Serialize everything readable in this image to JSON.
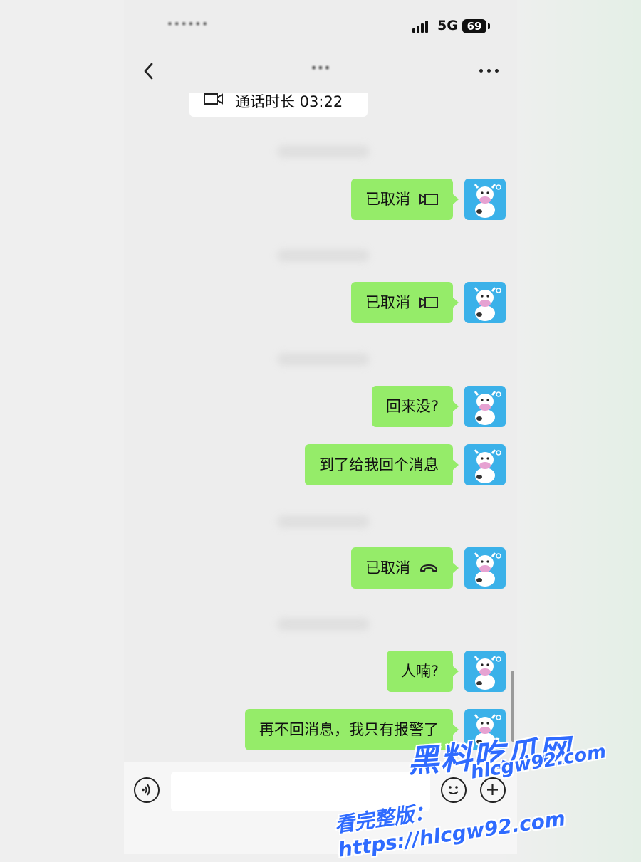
{
  "status_bar": {
    "time": "••••••",
    "network": "5G",
    "battery": "69"
  },
  "header": {
    "title": "•••"
  },
  "call_card": {
    "label": "通话时长 03:22",
    "icon": "video-icon"
  },
  "messages": [
    {
      "text": "已取消",
      "icon": "video-icon"
    },
    {
      "text": "已取消",
      "icon": "video-icon"
    },
    {
      "text": "回来没?"
    },
    {
      "text": "到了给我回个消息"
    },
    {
      "text": "已取消",
      "icon": "phone-hangup-icon"
    },
    {
      "text": "人喃?"
    },
    {
      "text": "再不回消息，我只有报警了"
    }
  ],
  "watermark": {
    "name": "黑料吃瓜网",
    "domain": "hlcgw92.com",
    "link": "看完整版：https://hlcgw92.com"
  },
  "colors": {
    "bubble": "#95ec69",
    "avatar": "#3bb1e9",
    "watermark": "#2f6bff",
    "chat_bg": "#ededed"
  }
}
